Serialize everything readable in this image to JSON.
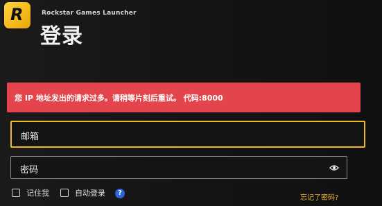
{
  "app": {
    "name": "Rockstar Games Launcher",
    "logo_letter": "R"
  },
  "page": {
    "title": "登录"
  },
  "error": {
    "message": "您 IP 地址发出的请求过多。请稍等片刻后重试。 代码:8000"
  },
  "form": {
    "email_label": "邮箱",
    "password_label": "密码",
    "remember_label": "记住我",
    "autologin_label": "自动登录",
    "help_symbol": "?",
    "forgot_label": "忘记了密码?"
  },
  "colors": {
    "accent": "#f0b824",
    "error": "#e4444b",
    "help": "#2f63d8"
  },
  "icons": {
    "logo": "rockstar-logo-icon",
    "show_password": "eye-icon",
    "help": "question-icon"
  }
}
